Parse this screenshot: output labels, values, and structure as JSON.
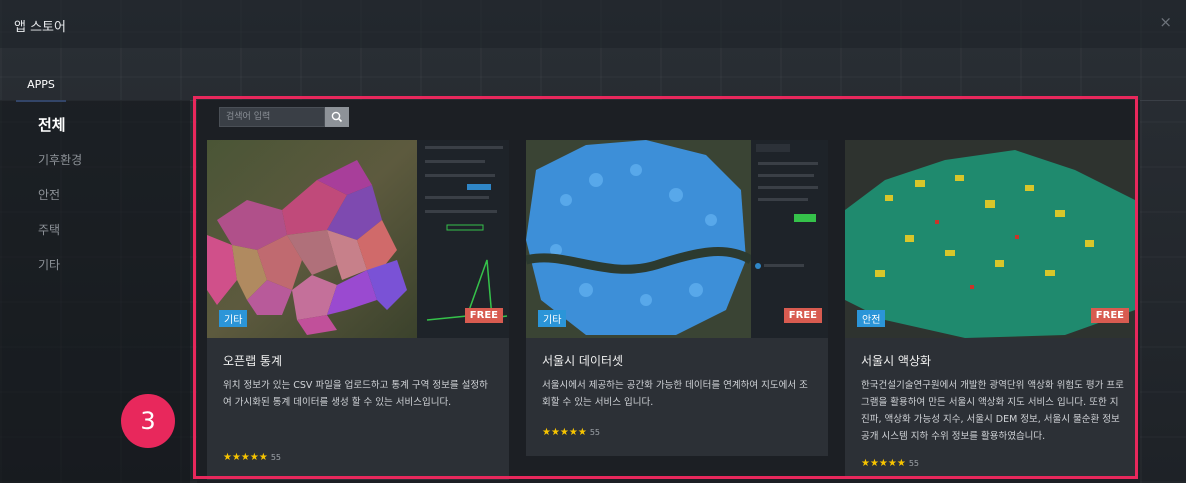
{
  "window": {
    "title": "앱 스토어",
    "close_glyph": "×"
  },
  "tabs": [
    {
      "label": "APPS"
    }
  ],
  "sidebar": {
    "items": [
      {
        "label": "전체"
      },
      {
        "label": "기후환경"
      },
      {
        "label": "안전"
      },
      {
        "label": "주택"
      },
      {
        "label": "기타"
      }
    ]
  },
  "search": {
    "placeholder": "검색어 입력",
    "icon": "search-icon"
  },
  "apps": [
    {
      "title": "오픈랩 통계",
      "description": "위치 정보가 있는 CSV 파일을 업로드하고 통계 구역 정보를 설정하여 가시화된 통계 데이터를 생성 할 수 있는 서비스입니다.",
      "category": "기타",
      "price": "FREE",
      "stars": "★★★★★",
      "rating_count": "55"
    },
    {
      "title": "서울시 데이터셋",
      "description": "서울시에서 제공하는 공간화 가능한 데이터를 연계하여 지도에서 조회할 수 있는 서비스 입니다.",
      "category": "기타",
      "price": "FREE",
      "stars": "★★★★★",
      "rating_count": "55"
    },
    {
      "title": "서울시 액상화",
      "description": "한국건설기술연구원에서 개발한 광역단위 액상화 위험도 평가 프로그램을 활용하여 만든 서울시 액상화 지도 서비스 입니다. 또한 지진파, 액상화 가능성 지수, 서울시 DEM 정보, 서울시 물순환 정보 공개 시스템 지하 수위 정보를 활용하였습니다.",
      "category": "안전",
      "price": "FREE",
      "stars": "★★★★★",
      "rating_count": "55"
    }
  ],
  "annotation": {
    "marker": "3"
  },
  "colors": {
    "accent": "#e8285c",
    "tag": "#2b95d8",
    "free": "#d85b50",
    "star": "#f7c400"
  }
}
